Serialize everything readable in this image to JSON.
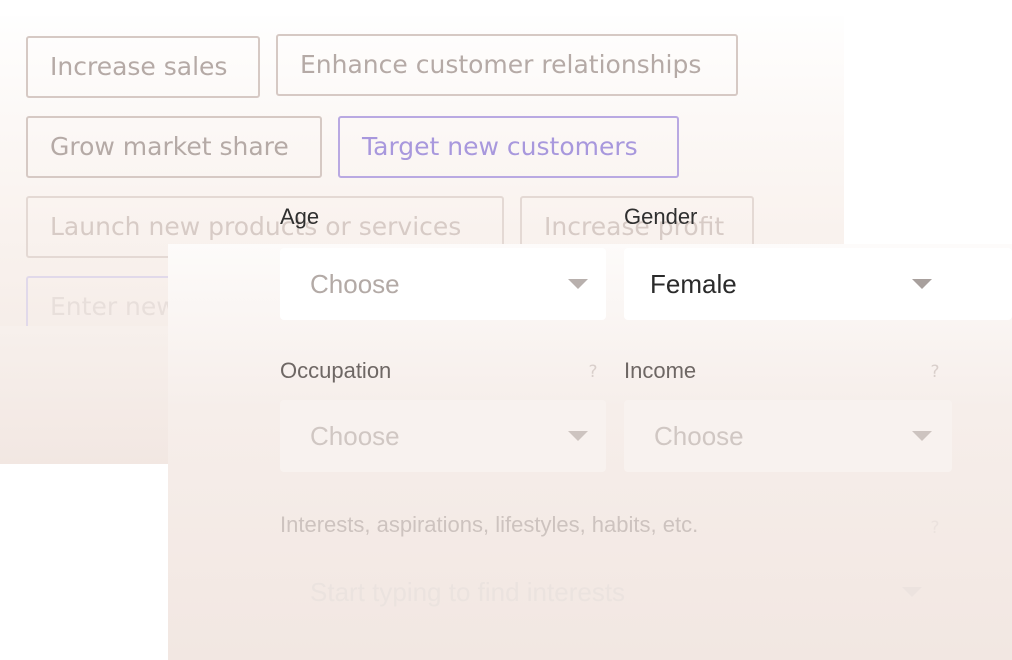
{
  "goals": {
    "chips": [
      {
        "label": "Increase sales",
        "selected": false
      },
      {
        "label": "Enhance customer relationships",
        "selected": false
      },
      {
        "label": "Grow market share",
        "selected": false
      },
      {
        "label": "Target new customers",
        "selected": true
      },
      {
        "label": "Launch new products or services",
        "selected": false
      },
      {
        "label": "Increase profit",
        "selected": false
      }
    ],
    "new_input_placeholder": "Enter new marketing goal"
  },
  "form": {
    "age": {
      "label": "Age",
      "value": "Choose"
    },
    "gender": {
      "label": "Gender",
      "value": "Female"
    },
    "occupation": {
      "label": "Occupation",
      "value": "Choose"
    },
    "income": {
      "label": "Income",
      "value": "Choose"
    },
    "interests": {
      "label": "Interests, aspirations, lifestyles, habits, etc.",
      "placeholder": "Start typing to find interests"
    }
  },
  "icons": {
    "help": "?",
    "caret": "chevron-down-icon"
  },
  "colors": {
    "selected_accent": "#a898dd",
    "chip_border": "#d6c9c4",
    "panel_tint": "#f2e7e2"
  }
}
